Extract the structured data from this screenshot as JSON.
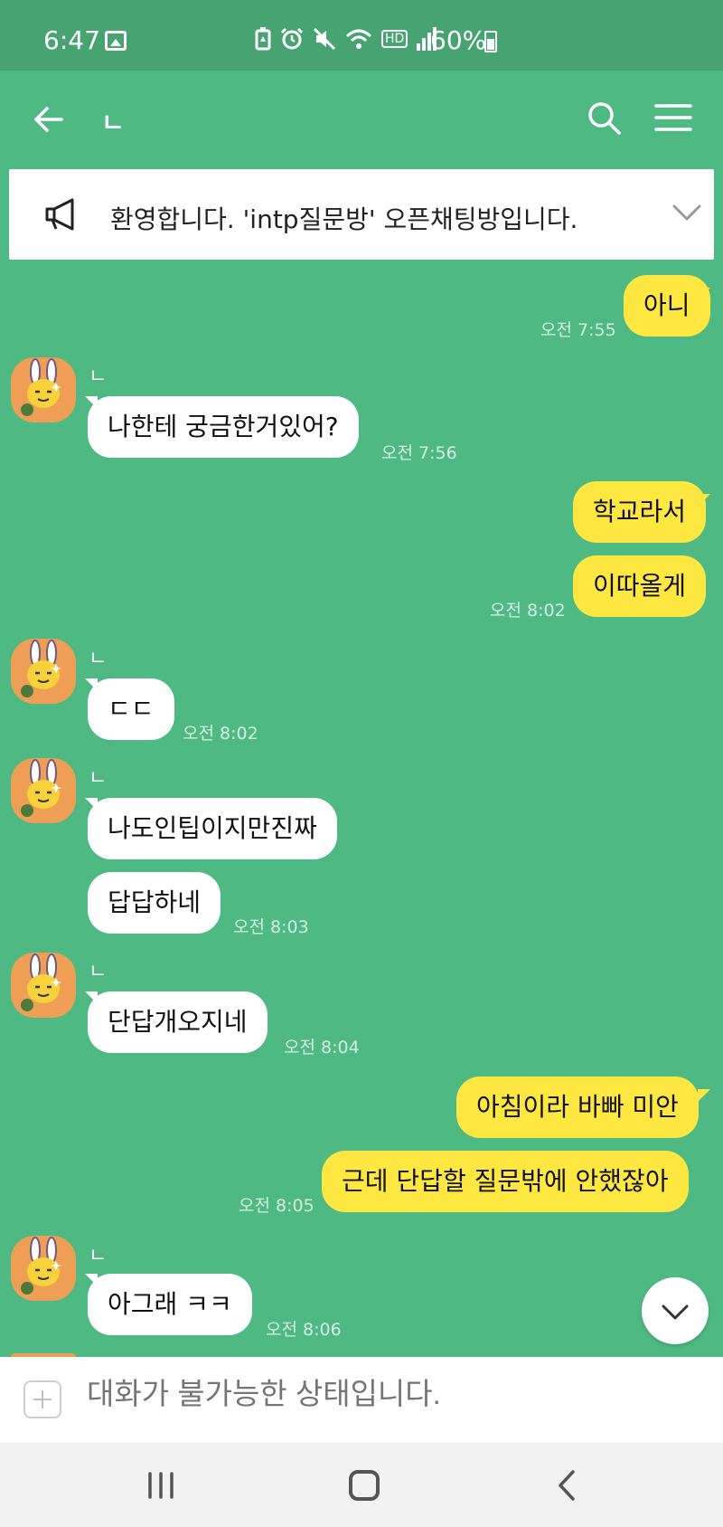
{
  "status_bar": {
    "time": "6:47",
    "battery": "60%",
    "icons": [
      "image-icon",
      "battery-saver-icon",
      "alarm-icon",
      "mute-icon",
      "wifi-icon",
      "hd-icon",
      "signal-icon",
      "battery-icon"
    ],
    "hd_label": "HD"
  },
  "header": {
    "title": "ㄴ",
    "back_icon": "arrow-left-icon",
    "search_icon": "search-icon",
    "menu_icon": "menu-icon"
  },
  "notice": {
    "icon": "megaphone-icon",
    "text": "환영합니다. 'intp질문방' 오픈채팅방입니다.",
    "expand_icon": "chevron-down-icon"
  },
  "messages": [
    {
      "from": "me",
      "text": "아니",
      "time": "오전 7:55"
    },
    {
      "from": "other",
      "name": "ㄴ",
      "text": "나한테 궁금한거있어?",
      "time": "오전 7:56"
    },
    {
      "from": "me",
      "text": "학교라서",
      "time": ""
    },
    {
      "from": "me",
      "text": "이따올게",
      "time": "오전 8:02"
    },
    {
      "from": "other",
      "name": "ㄴ",
      "text": "ㄷㄷ",
      "time": "오전 8:02"
    },
    {
      "from": "other",
      "name": "ㄴ",
      "text": "나도인팁이지만진짜",
      "time": ""
    },
    {
      "from": "other",
      "name": "",
      "text": "답답하네",
      "time": "오전 8:03"
    },
    {
      "from": "other",
      "name": "ㄴ",
      "text": "단답개오지네",
      "time": "오전 8:04"
    },
    {
      "from": "me",
      "text": "아침이라 바빠 미안",
      "time": ""
    },
    {
      "from": "me",
      "text": "근데 단답할 질문밖에 안했잖아",
      "time": "오전 8:05"
    },
    {
      "from": "other",
      "name": "ㄴ",
      "text": "아그래 ㅋㅋ",
      "time": "오전 8:06"
    }
  ],
  "scroll_down_icon": "chevron-down-icon",
  "input": {
    "placeholder": "대화가 불가능한 상태입니다.",
    "attach_icon": "plus-icon"
  },
  "nav": {
    "icons": [
      "recent-apps-icon",
      "home-icon",
      "back-icon"
    ]
  },
  "colors": {
    "background": "#4fb983",
    "status_bar": "#47a472",
    "my_bubble": "#fee740",
    "other_bubble": "#ffffff",
    "avatar": "#ee9f55"
  }
}
